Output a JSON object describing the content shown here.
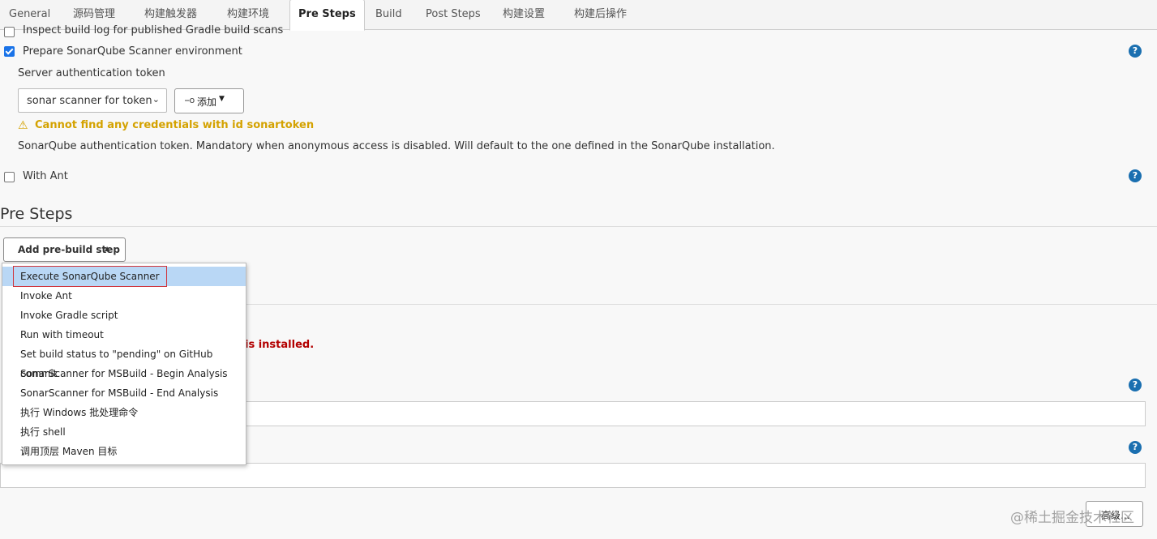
{
  "tabs": [
    {
      "label": "General"
    },
    {
      "label": "源码管理"
    },
    {
      "label": "构建触发器"
    },
    {
      "label": "构建环境"
    },
    {
      "label": "Pre Steps",
      "active": true
    },
    {
      "label": "Build"
    },
    {
      "label": "Post Steps"
    },
    {
      "label": "构建设置"
    },
    {
      "label": "构建后操作"
    }
  ],
  "env": {
    "inspect_gradle_label": "Inspect build log for published Gradle build scans",
    "inspect_gradle_checked": false,
    "prepare_sonar_label": "Prepare SonarQube Scanner environment",
    "prepare_sonar_checked": true,
    "server_token_label": "Server authentication token",
    "credential_select_value": "sonar scanner for token",
    "add_button_label": "添加",
    "warning_text": "Cannot find any credentials with id sonartoken",
    "token_help_text": "SonarQube authentication token. Mandatory when anonymous access is disabled. Will default to the one defined in the SonarQube installation.",
    "with_ant_label": "With Ant",
    "with_ant_checked": false
  },
  "pre_steps": {
    "title": "Pre Steps",
    "add_button_label": "Add pre-build step",
    "menu_items": [
      "Execute SonarQube Scanner",
      "Invoke Ant",
      "Invoke Gradle script",
      "Run with timeout",
      "Set build status to \"pending\" on GitHub commit",
      "SonarScanner for MSBuild - Begin Analysis",
      "SonarScanner for MSBuild - End Analysis",
      "执行 Windows 批处理命令",
      "执行 shell",
      "调用顶层 Maven 目标"
    ],
    "highlighted_item": "Execute SonarQube Scanner",
    "error_fragment": "is installed.",
    "advanced_button_label": "高级..."
  },
  "watermark": "@稀土掘金技术社区",
  "help_glyph": "?",
  "icons": {
    "key": "key-icon",
    "warning": "warning-icon",
    "help": "help-icon"
  },
  "colors": {
    "accent": "#1a73e8",
    "warning": "#d4a200",
    "error": "#b30000",
    "help": "#1a6fb0"
  }
}
